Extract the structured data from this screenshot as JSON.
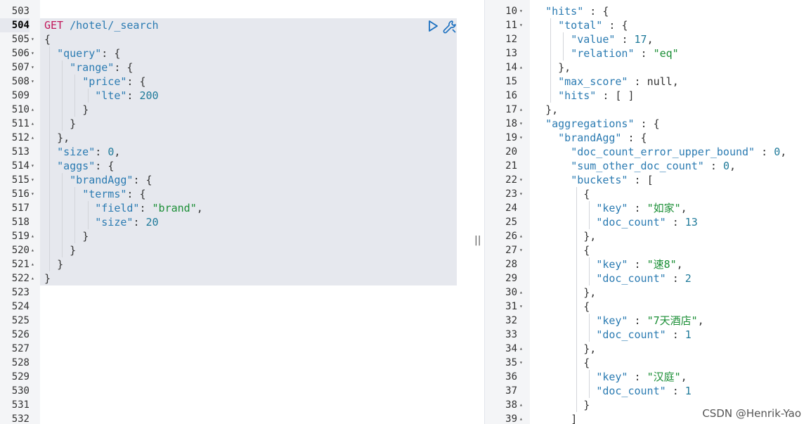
{
  "request_editor": {
    "method": "GET",
    "path": "/hotel/_search",
    "active_line": 504,
    "line_numbers": [
      503,
      504,
      505,
      506,
      507,
      508,
      509,
      510,
      511,
      512,
      513,
      514,
      515,
      516,
      517,
      518,
      519,
      520,
      521,
      522,
      523,
      524,
      525,
      526,
      527,
      528,
      529,
      530,
      531,
      532
    ],
    "lines": [
      "",
      "GET /hotel/_search",
      "{",
      "  \"query\": {",
      "    \"range\": {",
      "      \"price\": {",
      "        \"lte\": 200",
      "      }",
      "    }",
      "  },",
      "  \"size\": 0,",
      "  \"aggs\": {",
      "    \"brandAgg\": {",
      "      \"terms\": {",
      "        \"field\": \"brand\",",
      "        \"size\": 20",
      "      }",
      "    }",
      "  }",
      "}",
      "",
      "",
      "",
      "",
      "",
      "",
      "",
      "",
      "",
      ""
    ]
  },
  "response_viewer": {
    "line_numbers": [
      10,
      11,
      12,
      13,
      14,
      15,
      16,
      17,
      18,
      19,
      20,
      21,
      22,
      23,
      24,
      25,
      26,
      27,
      28,
      29,
      30,
      31,
      32,
      33,
      34,
      35,
      36,
      37,
      38,
      39
    ],
    "lines": [
      "  \"hits\" : {",
      "    \"total\" : {",
      "      \"value\" : 17,",
      "      \"relation\" : \"eq\"",
      "    },",
      "    \"max_score\" : null,",
      "    \"hits\" : [ ]",
      "  },",
      "  \"aggregations\" : {",
      "    \"brandAgg\" : {",
      "      \"doc_count_error_upper_bound\" : 0,",
      "      \"sum_other_doc_count\" : 0,",
      "      \"buckets\" : [",
      "        {",
      "          \"key\" : \"如家\",",
      "          \"doc_count\" : 13",
      "        },",
      "        {",
      "          \"key\" : \"速8\",",
      "          \"doc_count\" : 2",
      "        },",
      "        {",
      "          \"key\" : \"7天酒店\",",
      "          \"doc_count\" : 1",
      "        },",
      "        {",
      "          \"key\" : \"汉庭\",",
      "          \"doc_count\" : 1",
      "        }",
      "      ]"
    ]
  },
  "divider_grip": "||",
  "watermark": "CSDN @Henrik-Yao",
  "icons": {
    "run": "play-icon",
    "tools": "wrench-icon",
    "fold_open": "triangle-down",
    "fold_close": "triangle-up"
  }
}
